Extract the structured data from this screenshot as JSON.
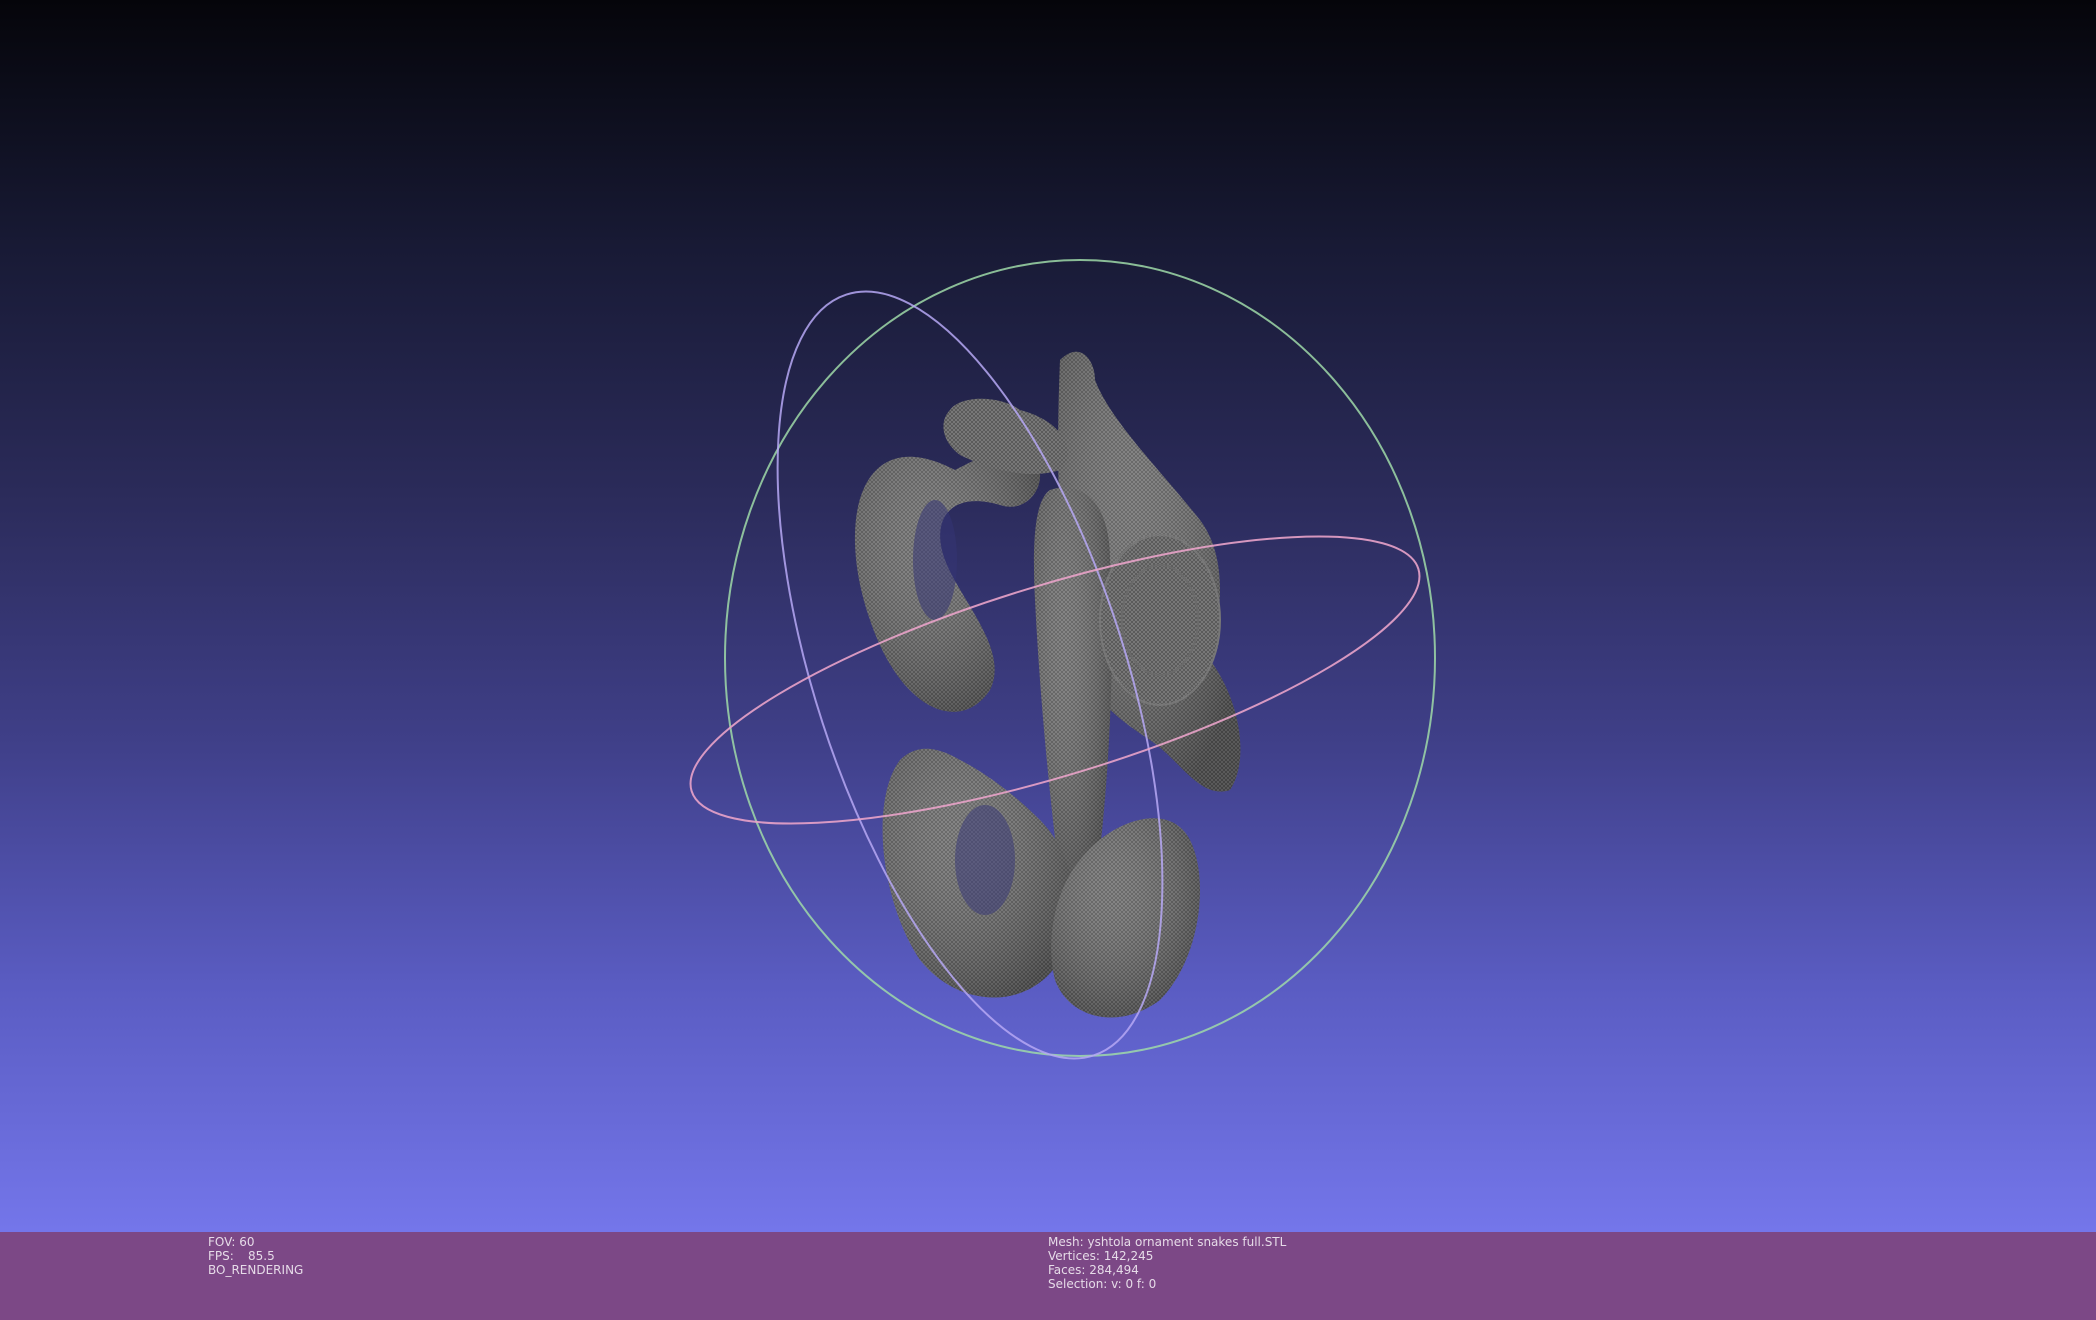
{
  "viewer": {
    "gradient_top": "#05050a",
    "gradient_bottom": "#7476ea",
    "mesh_color": "#5a5a5a",
    "trackball_colors": {
      "ring_x": "#e9a3c9",
      "ring_y": "#9fd9a8",
      "ring_z": "#b6a8f4"
    }
  },
  "status": {
    "background": "#7c4886",
    "left": {
      "fov_label": "FOV:",
      "fov_value": "60",
      "fps_label": "FPS:",
      "fps_value": "85.5",
      "mode": "BO_RENDERING"
    },
    "right": {
      "mesh_label": "Mesh:",
      "mesh_name": "yshtola ornament snakes full.STL",
      "vertices_label": "Vertices:",
      "vertices_value": "142,245",
      "faces_label": "Faces:",
      "faces_value": "284,494",
      "selection_label": "Selection:",
      "selection_value": "v: 0 f: 0"
    }
  }
}
